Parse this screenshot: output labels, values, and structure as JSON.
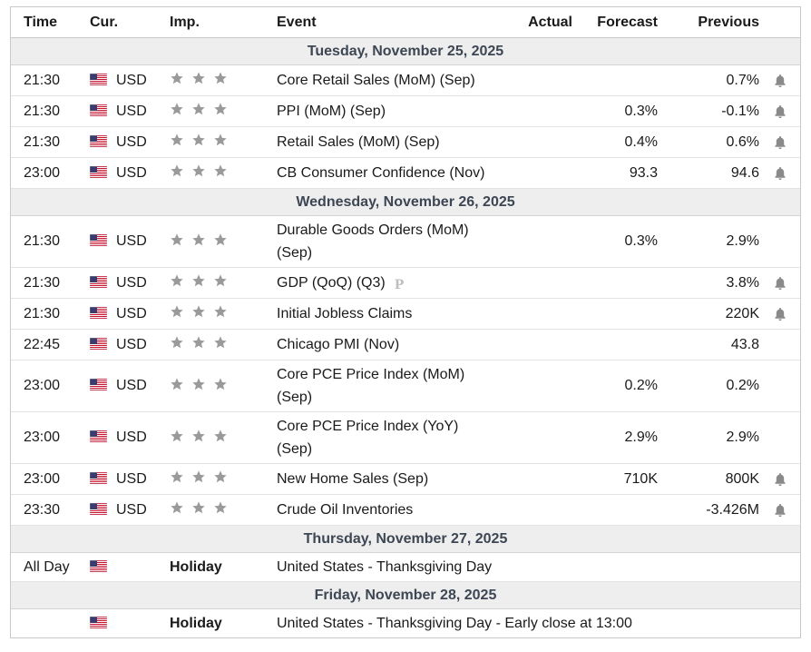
{
  "headers": {
    "time": "Time",
    "currency": "Cur.",
    "importance": "Imp.",
    "event": "Event",
    "actual": "Actual",
    "forecast": "Forecast",
    "previous": "Previous"
  },
  "colors": {
    "star": "#9a9a9a",
    "bell": "#8a8a8a",
    "day_bg": "#eeeeee",
    "day_text": "#3d4653",
    "border": "#c9c9c9"
  },
  "days": [
    {
      "label": "Tuesday, November 25, 2025",
      "events": [
        {
          "time": "21:30",
          "currency": "USD",
          "event": "Core Retail Sales (MoM) (Sep)",
          "actual": "",
          "forecast": "",
          "previous": "0.7%",
          "alert": true
        },
        {
          "time": "21:30",
          "currency": "USD",
          "event": "PPI (MoM) (Sep)",
          "actual": "",
          "forecast": "0.3%",
          "previous": "-0.1%",
          "alert": true
        },
        {
          "time": "21:30",
          "currency": "USD",
          "event": "Retail Sales (MoM) (Sep)",
          "actual": "",
          "forecast": "0.4%",
          "previous": "0.6%",
          "alert": true
        },
        {
          "time": "23:00",
          "currency": "USD",
          "event": "CB Consumer Confidence (Nov)",
          "actual": "",
          "forecast": "93.3",
          "previous": "94.6",
          "alert": true
        }
      ]
    },
    {
      "label": "Wednesday, November 26, 2025",
      "events": [
        {
          "time": "21:30",
          "currency": "USD",
          "event": "Durable Goods Orders (MoM) (Sep)",
          "actual": "",
          "forecast": "0.3%",
          "previous": "2.9%",
          "alert": false
        },
        {
          "time": "21:30",
          "currency": "USD",
          "event": "GDP (QoQ) (Q3)",
          "preliminary": "P",
          "actual": "",
          "forecast": "",
          "previous": "3.8%",
          "alert": true
        },
        {
          "time": "21:30",
          "currency": "USD",
          "event": "Initial Jobless Claims",
          "actual": "",
          "forecast": "",
          "previous": "220K",
          "alert": true
        },
        {
          "time": "22:45",
          "currency": "USD",
          "event": "Chicago PMI (Nov)",
          "actual": "",
          "forecast": "",
          "previous": "43.8",
          "alert": false
        },
        {
          "time": "23:00",
          "currency": "USD",
          "event": "Core PCE Price Index (MoM) (Sep)",
          "actual": "",
          "forecast": "0.2%",
          "previous": "0.2%",
          "alert": false
        },
        {
          "time": "23:00",
          "currency": "USD",
          "event": "Core PCE Price Index (YoY) (Sep)",
          "actual": "",
          "forecast": "2.9%",
          "previous": "2.9%",
          "alert": false
        },
        {
          "time": "23:00",
          "currency": "USD",
          "event": "New Home Sales (Sep)",
          "actual": "",
          "forecast": "710K",
          "previous": "800K",
          "alert": true
        },
        {
          "time": "23:30",
          "currency": "USD",
          "event": "Crude Oil Inventories",
          "actual": "",
          "forecast": "",
          "previous": "-3.426M",
          "alert": true
        }
      ]
    },
    {
      "label": "Thursday, November 27, 2025",
      "holiday": {
        "time": "All Day",
        "importance": "Holiday",
        "event": "United States - Thanksgiving Day"
      }
    },
    {
      "label": "Friday, November 28, 2025",
      "holiday": {
        "time": "",
        "importance": "Holiday",
        "event": "United States - Thanksgiving Day - Early close at 13:00"
      }
    }
  ]
}
